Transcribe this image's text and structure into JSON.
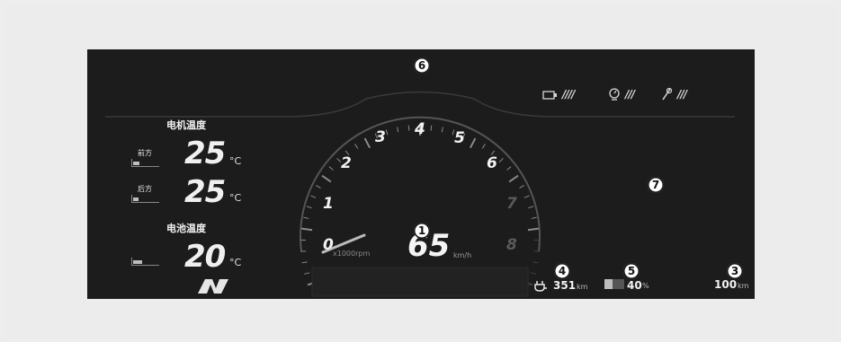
{
  "left_panel": {
    "motor_temp_title": "电机温度",
    "front_label": "前方",
    "front_temp": "25",
    "rear_label": "后方",
    "rear_temp": "25",
    "battery_temp_title": "电池温度",
    "battery_temp": "20",
    "temp_unit": "°C",
    "front_gauge_level": 0.25,
    "rear_gauge_level": 0.2,
    "battery_gauge_level": 0.35
  },
  "speedometer": {
    "ticks": [
      "0",
      "1",
      "2",
      "3",
      "4",
      "5",
      "6",
      "7",
      "8"
    ],
    "scale_label": "x1000rpm",
    "speed": "65",
    "speed_unit": "km/h"
  },
  "indicators": {
    "marks_1": "////",
    "marks_2": "///",
    "marks_3": "///"
  },
  "bottom": {
    "range_value": "351",
    "range_unit": "km",
    "battery_pct": "40",
    "battery_unit": "%",
    "trip_value": "100",
    "trip_unit": "km"
  },
  "callouts": {
    "c1": "1",
    "c3": "3",
    "c4": "4",
    "c5": "5",
    "c6": "6",
    "c7": "7"
  },
  "colors": {
    "screen_bg": "#1c1c1c",
    "frame_bg": "#ececec",
    "text": "#f2f2f2",
    "dim_tick": "#5a5a5a"
  }
}
